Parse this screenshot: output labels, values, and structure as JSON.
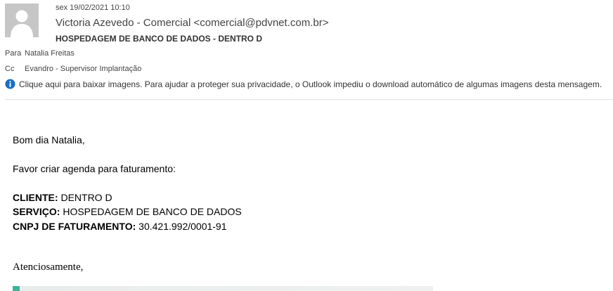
{
  "email": {
    "date": "sex 19/02/2021 10:10",
    "sender": "Victoria Azevedo - Comercial <comercial@pdvnet.com.br>",
    "subject": "HOSPEDAGEM DE BANCO DE DADOS - DENTRO D",
    "to_label": "Para",
    "to_value": "Natalia Freitas",
    "cc_label": "Cc",
    "cc_value": "Evandro - Supervisor Implantação",
    "info_message": "Clique aqui para baixar imagens. Para ajudar a proteger sua privacidade, o Outlook impediu o download automático de algumas imagens desta mensagem."
  },
  "body": {
    "greeting": "Bom dia Natalia,",
    "request": "Favor criar agenda para faturamento:",
    "client_label": "CLIENTE:",
    "client_value": " DENTRO D",
    "service_label": "SERVIÇO:",
    "service_value": " HOSPEDAGEM DE BANCO DE DADOS",
    "cnpj_label": "CNPJ DE FATURAMENTO:",
    "cnpj_value": " 30.421.992/0001-91",
    "closing": "Atenciosamente,"
  },
  "colors": {
    "info_icon": "#1a6fc4",
    "signature_accent": "#3db39a"
  }
}
